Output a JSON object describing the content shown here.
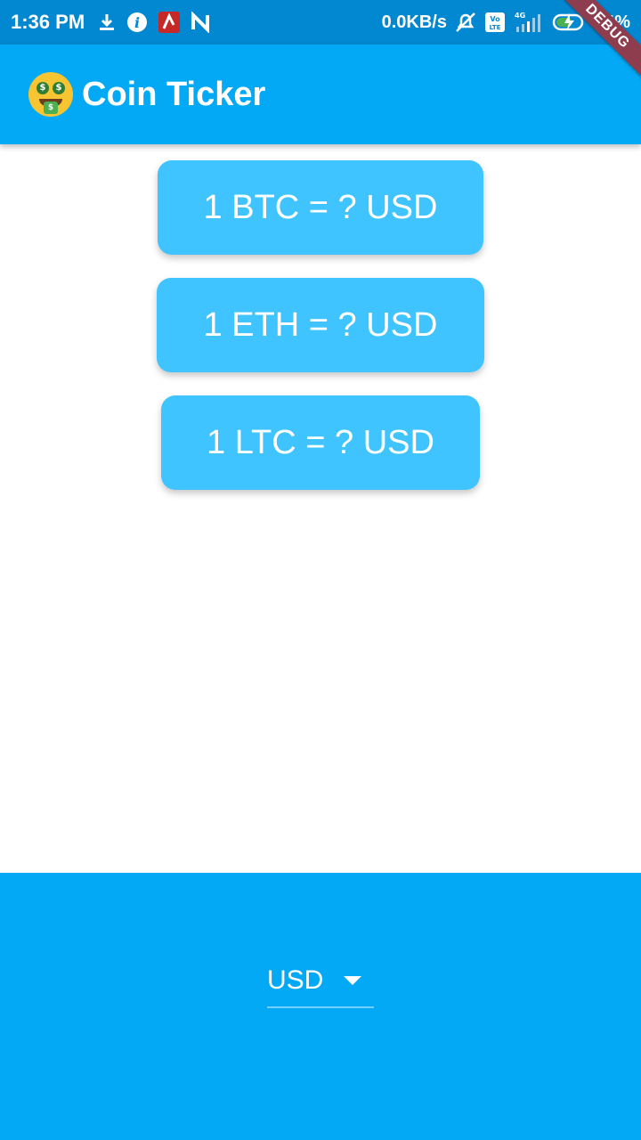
{
  "status_bar": {
    "time": "1:36 PM",
    "speed": "0.0KB/s",
    "network": "4G",
    "volte": "Vo LTE",
    "battery": "64%"
  },
  "debug_banner": "DEBUG",
  "app_bar": {
    "title": "Coin Ticker",
    "icon": "money-mouth-face-icon",
    "color": "#03a9f4"
  },
  "rates": [
    {
      "label": "1 BTC = ? USD"
    },
    {
      "label": "1 ETH = ? USD"
    },
    {
      "label": "1 LTC = ? USD"
    }
  ],
  "picker": {
    "selected": "USD",
    "color": "#03a9f4"
  },
  "colors": {
    "status_bar": "#0288d1",
    "card": "#40c4ff"
  }
}
